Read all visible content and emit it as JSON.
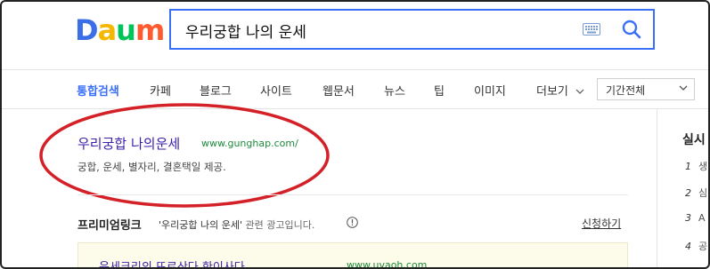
{
  "logo": {
    "letters": [
      "D",
      "a",
      "u",
      "m"
    ],
    "colors": [
      "#3b6fe8",
      "#f5b800",
      "#00c35a",
      "#ff5b2e"
    ]
  },
  "search": {
    "query": "우리궁합 나의 운세"
  },
  "nav": {
    "tabs": [
      {
        "label": "통합검색",
        "active": true
      },
      {
        "label": "카페"
      },
      {
        "label": "블로그"
      },
      {
        "label": "사이트"
      },
      {
        "label": "웹문서"
      },
      {
        "label": "뉴스"
      },
      {
        "label": "팁"
      },
      {
        "label": "이미지"
      },
      {
        "label": "더보기"
      }
    ],
    "period": "기간전체"
  },
  "result": {
    "title": "우리궁합 나의운세",
    "url": "www.gunghap.com/",
    "desc": "궁합, 운세, 별자리, 결혼택일 제공."
  },
  "premium": {
    "label": "프리미엄링크",
    "query": "'우리궁합 나의 운세'",
    "suffix": " 관련 광고입니다.",
    "apply": "신청하기"
  },
  "ad": {
    "title": "운세크리의 뜨로산다 한이사다",
    "url": "www.uvaoh.com"
  },
  "side": {
    "title": "실시",
    "items": [
      {
        "num": "1",
        "text": "생"
      },
      {
        "num": "2",
        "text": "심"
      },
      {
        "num": "3",
        "text": "A"
      },
      {
        "num": "4",
        "text": "공"
      }
    ]
  },
  "accent": "#3a6ff7",
  "annotation_color": "#d42027"
}
